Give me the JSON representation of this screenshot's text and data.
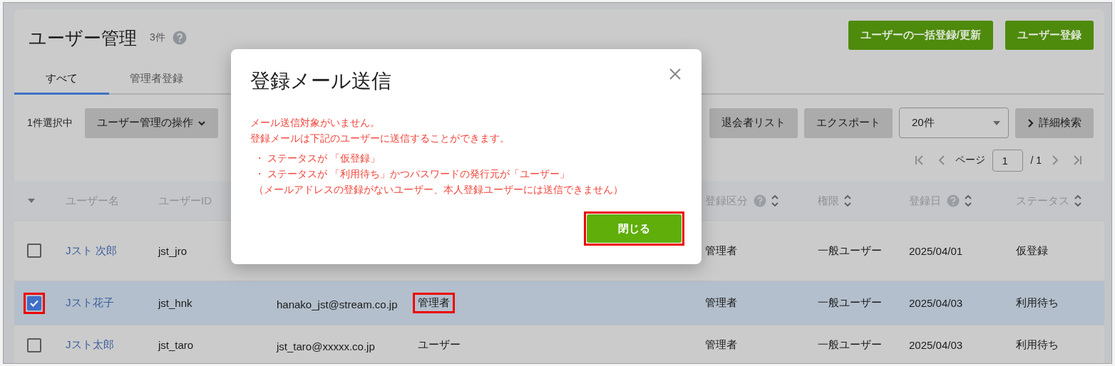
{
  "header": {
    "title": "ユーザー管理",
    "count": "3件",
    "actions": [
      "ユーザーの一括登録/更新",
      "ユーザー登録"
    ]
  },
  "tabs": [
    {
      "label": "すべて",
      "selected": true
    },
    {
      "label": "管理者登録",
      "selected": false
    }
  ],
  "toolbar": {
    "selection": "1件選択中",
    "operations_button": "ユーザー管理の操作",
    "buttons": [
      "退会者リスト",
      "エクスポート"
    ],
    "page_size": "20件",
    "advanced_search": "詳細検索"
  },
  "pagination": {
    "label": "ページ",
    "page": "1",
    "total": "/ 1"
  },
  "table": {
    "columns": [
      {
        "label": "ユーザー名",
        "help": false,
        "sortable": false
      },
      {
        "label": "ユーザーID",
        "help": false,
        "sortable": false
      },
      {
        "label": "登録区分",
        "help": true,
        "sortable": true
      },
      {
        "label": "権限",
        "help": false,
        "sortable": true
      },
      {
        "label": "登録日",
        "help": true,
        "sortable": true
      },
      {
        "label": "ステータス",
        "help": false,
        "sortable": true
      }
    ],
    "rows": [
      {
        "selected": false,
        "checked": false,
        "check_highlighted": false,
        "name": "Jスト 次郎",
        "user_id": "jst_jro",
        "category": "管理者",
        "permission": "一般ユーザー",
        "registered": "2025/04/01",
        "status": "仮登録"
      },
      {
        "selected": true,
        "checked": true,
        "check_highlighted": true,
        "name": "Jスト花子",
        "user_id": "jst_hnk",
        "email": "hanako_jst@stream.co.jp",
        "role": "管理者",
        "role_highlighted": true,
        "category": "管理者",
        "permission": "一般ユーザー",
        "registered": "2025/04/03",
        "status": "利用待ち"
      },
      {
        "selected": false,
        "checked": false,
        "check_highlighted": false,
        "name": "Jスト太郎",
        "user_id": "jst_taro",
        "email": "jst_taro@xxxxx.co.jp",
        "role": "ユーザー",
        "role_highlighted": false,
        "category": "管理者",
        "permission": "一般ユーザー",
        "registered": "2025/04/03",
        "status": "利用待ち"
      }
    ]
  },
  "dialog": {
    "title": "登録メール送信",
    "messages": [
      "メール送信対象がいません。",
      "登録メールは下記のユーザーに送信することができます。"
    ],
    "conditions": [
      "・ ステータスが 「仮登録」",
      "・ ステータスが 「利用待ち」かつパスワードの発行元が「ユーザー」"
    ],
    "note": "（メールアドレスの登録がないユーザー、本人登録ユーザーには送信できません）",
    "close_button": {
      "label": "閉じる",
      "highlighted": true
    }
  }
}
